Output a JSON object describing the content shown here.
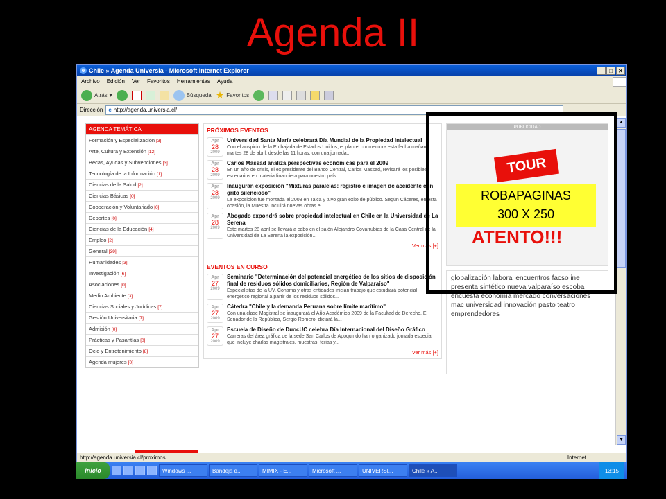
{
  "slide": {
    "title": "Agenda II"
  },
  "window": {
    "title": "Chile » Agenda Universia - Microsoft Internet Explorer",
    "controls": [
      "_",
      "□",
      "✕"
    ]
  },
  "menu": [
    "Archivo",
    "Edición",
    "Ver",
    "Favoritos",
    "Herramientas",
    "Ayuda"
  ],
  "toolbar": {
    "back": "Atrás",
    "search": "Búsqueda",
    "favorites": "Favoritos"
  },
  "address": {
    "label": "Dirección",
    "url": "http://agenda.universia.cl/"
  },
  "agenda": {
    "heading": "AGENDA TEMÁTICA",
    "items": [
      {
        "label": "Formación y Especialización",
        "count": "[3]"
      },
      {
        "label": "Arte, Cultura y Extensión",
        "count": "[12]"
      },
      {
        "label": "Becas, Ayudas y Subvenciones",
        "count": "[3]"
      },
      {
        "label": "Tecnología de la Información",
        "count": "[1]"
      },
      {
        "label": "Ciencias de la Salud",
        "count": "[2]"
      },
      {
        "label": "Ciencias Básicas",
        "count": "[0]"
      },
      {
        "label": "Cooperación y Voluntariado",
        "count": "[0]"
      },
      {
        "label": "Deportes",
        "count": "[0]"
      },
      {
        "label": "Ciencias de la Educación",
        "count": "[4]"
      },
      {
        "label": "Empleo",
        "count": "[2]"
      },
      {
        "label": "General",
        "count": "[39]"
      },
      {
        "label": "Humanidades",
        "count": "[3]"
      },
      {
        "label": "Investigación",
        "count": "[6]"
      },
      {
        "label": "Asociaciones",
        "count": "[0]"
      },
      {
        "label": "Medio Ambiente",
        "count": "[3]"
      },
      {
        "label": "Ciencias Sociales y Jurídicas",
        "count": "[7]"
      },
      {
        "label": "Gestión Universitaria",
        "count": "[7]"
      },
      {
        "label": "Admisión",
        "count": "[0]"
      },
      {
        "label": "Prácticas y Pasantías",
        "count": "[0]"
      },
      {
        "label": "Ocio y Entretenimiento",
        "count": "[8]"
      },
      {
        "label": "Agenda mujeres",
        "count": "[0]"
      }
    ]
  },
  "proximos": {
    "heading": "PRÓXIMOS EVENTOS",
    "more": "Ver más",
    "more_suffix": "[+]",
    "events": [
      {
        "m": "Apr",
        "d": "28",
        "y": "2009",
        "title": "Universidad Santa María celebrará Día Mundial de la Propiedad Intelectual",
        "desc": "Con el auspicio de la Embajada de Estados Unidos, el plantel conmemora esta fecha mañana martes 28 de abril, desde las 11 horas, con una jornada..."
      },
      {
        "m": "Apr",
        "d": "28",
        "y": "2009",
        "title": "Carlos Massad analiza perspectivas económicas para el 2009",
        "desc": "En un año de crisis, el ex presidente del Banco Central, Carlos Massad, revisará los posibles escenarios en materia financiera para nuestro país..."
      },
      {
        "m": "Apr",
        "d": "28",
        "y": "2009",
        "title": "Inauguran exposición \"Mixturas paralelas: registro e imagen de accidente con grito silencioso\"",
        "desc": "La exposición fue montada el 2008 en Talca y tuvo gran éxito de público. Según Cáceres, en esta ocasión, la Muestra incluirá nuevas obras e..."
      },
      {
        "m": "Apr",
        "d": "28",
        "y": "2009",
        "title": "Abogado expondrá sobre propiedad intelectual en Chile en la Universidad de La Serena",
        "desc": "Este martes 28 abril se llevará a cabo en el salón Alejandro Covarrubias de la Casa Central de la Universidad de La Serena la exposición..."
      }
    ]
  },
  "encurso": {
    "heading": "EVENTOS EN CURSO",
    "more": "Ver más",
    "more_suffix": "[+]",
    "events": [
      {
        "m": "Apr",
        "d": "27",
        "y": "2009",
        "title": "Seminario \"Determinación del potencial energético de los sitios de disposición final de residuos sólidos domiciliarios, Región de Valparaíso\"",
        "desc": "Especialistas de la UV, Conama y otras entidades inician trabajo que estudiará potencial energético regional a partir de los residuos sólidos..."
      },
      {
        "m": "Apr",
        "d": "27",
        "y": "2009",
        "title": "Cátedra \"Chile y la demanda Peruana sobre límite marítimo\"",
        "desc": "Con una clase Magistral se inaugurará el Año Académico 2009 de la Facultad de Derecho. El Senador de la República, Sergio Romero, dictará la..."
      },
      {
        "m": "Apr",
        "d": "27",
        "y": "2009",
        "title": "Escuela de Diseño de DuocUC celebra Día Internacional del Diseño Gráfico",
        "desc": "Carreras del área gráfica de la sede San Carlos de Apoquindo han organizado jornada especial que incluye charlas magistrales, muestras, ferias y..."
      }
    ]
  },
  "ad": {
    "heading": "PUBLICIDAD",
    "tour": "TOUR",
    "atento": "ATENTO!!!"
  },
  "tags": "globalización laboral encuentros facso ine presenta sintético nueva valparaíso escoba encuesta economía mercado conversaciones mac universidad innovación pasto teatro emprendedores",
  "robapaginas": {
    "line1": "ROBAPAGINAS",
    "line2": "300 X 250"
  },
  "status": {
    "url": "http://agenda.universia.cl/proximos",
    "zone": "Internet"
  },
  "taskbar": {
    "start": "Inicio",
    "tasks": [
      "Windows ...",
      "Bandeja d...",
      "MIMIX - E...",
      "Microsoft ...",
      "UNIVERSI...",
      "Chile » A..."
    ],
    "clock": "13:15"
  },
  "colors": {
    "accent": "#e8100b",
    "robapaginas_fill": "#ffff33"
  }
}
